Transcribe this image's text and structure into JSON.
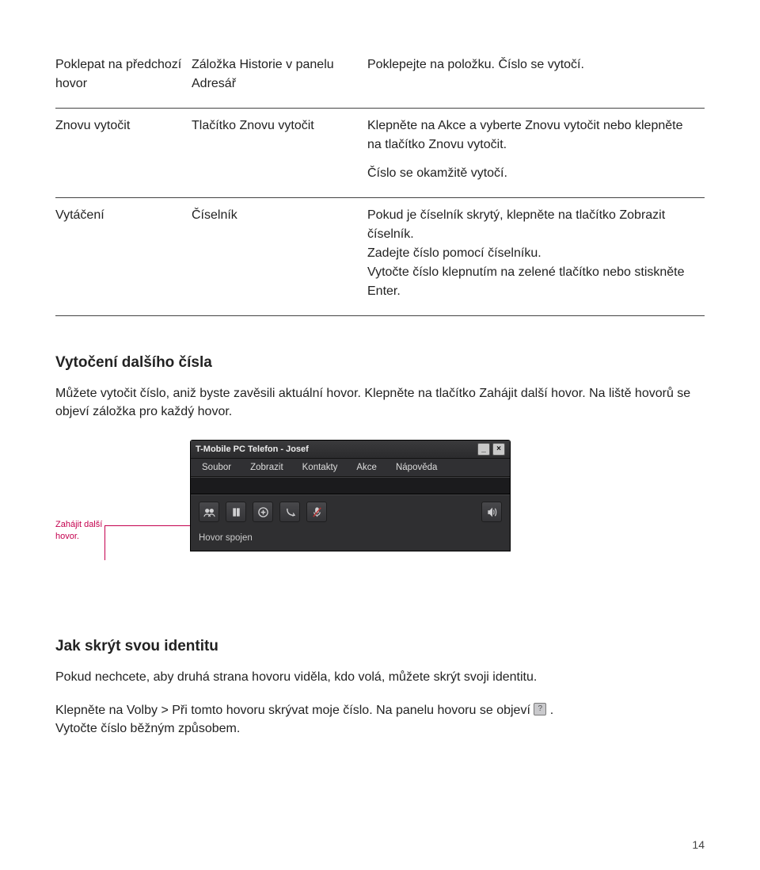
{
  "table": {
    "rows": [
      {
        "col1": "Poklepat na předchozí hovor",
        "col2": "Záložka Historie v panelu Adresář",
        "col3": "Poklepejte na položku. Číslo se vytočí."
      },
      {
        "col1": "Znovu vytočit",
        "col2": "Tlačítko Znovu vytočit",
        "col3": "Klepněte na Akce a vyberte Znovu vytočit nebo klepněte na tlačítko Znovu vytočit.",
        "col3b": "Číslo se okamžitě vytočí."
      },
      {
        "col1": "Vytáčení",
        "col2": "Číselník",
        "col3": "Pokud je číselník skrytý, klepněte na tlačítko Zobrazit číselník.\nZadejte číslo pomocí číselníku.\nVytočte číslo klepnutím na zelené tlačítko nebo stiskněte Enter."
      }
    ]
  },
  "section1": {
    "heading": "Vytočení dalšího čísla",
    "paragraph": "Můžete vytočit číslo, aniž byste zavěsili aktuální hovor. Klepněte na tlačítko Zahájit další hovor. Na liště hovorů se objeví záložka pro každý hovor."
  },
  "callout_label": "Zahájit další hovor.",
  "app": {
    "title": "T-Mobile PC Telefon - Josef",
    "menu": [
      "Soubor",
      "Zobrazit",
      "Kontakty",
      "Akce",
      "Nápověda"
    ],
    "status": "Hovor spojen",
    "icons": {
      "conference": "conference-icon",
      "pause": "pause-icon",
      "add_call": "add-call-icon",
      "transfer": "transfer-icon",
      "mute": "mute-icon",
      "speaker": "speaker-icon"
    }
  },
  "section2": {
    "heading": "Jak skrýt svou identitu",
    "p1": "Pokud nechcete, aby druhá strana hovoru viděla, kdo volá, můžete skrýt svoji identitu.",
    "p2a": "Klepněte na Volby > Při tomto hovoru skrývat moje číslo. Na panelu hovoru se objeví ",
    "p2b": " .",
    "p3": "Vytočte číslo běžným způsobem."
  },
  "page_number": "14"
}
